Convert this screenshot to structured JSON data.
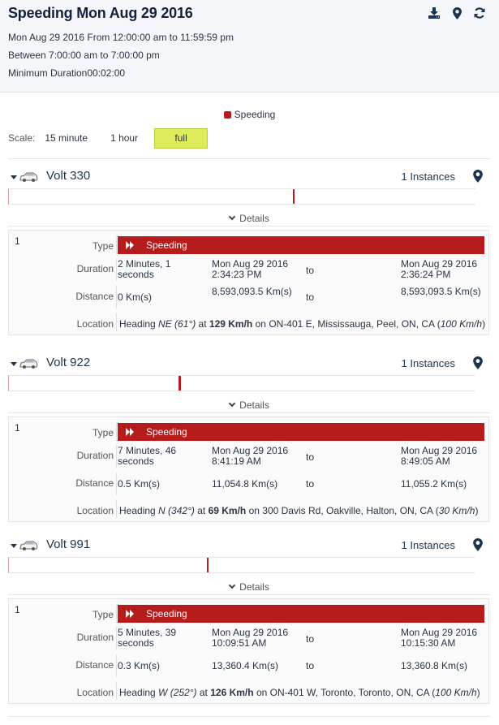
{
  "header": {
    "title": "Speeding Mon Aug 29 2016",
    "date_range": "Mon Aug 29 2016 From 12:00:00 am to 11:59:59 pm",
    "between": "Between 7:00:00 am to 7:00:00 pm",
    "min_duration": "Minimum Duration00:02:00",
    "tools": [
      "download-icon",
      "map-pin-icon",
      "refresh-icon"
    ]
  },
  "legend": {
    "label": "Speeding",
    "color": "#b71c1c"
  },
  "scale": {
    "label": "Scale:",
    "options": [
      "15 minute",
      "1 hour",
      "full"
    ],
    "selected": "full",
    "highlight_color": "#dcec5c"
  },
  "timeline": {
    "range_hours": [
      0,
      24
    ]
  },
  "labels": {
    "details": "Details",
    "type": "Type",
    "duration": "Duration",
    "distance": "Distance",
    "location": "Location",
    "to": "to",
    "heading": "Heading",
    "at": "at",
    "on": "on"
  },
  "vehicles": [
    {
      "name": "Volt 330",
      "instances": "1 Instances",
      "events": [
        {
          "index": "1",
          "type": "Speeding",
          "start_hour": 14.573,
          "end_hour": 14.607,
          "duration": "2 Minutes, 1 seconds",
          "start_time": "Mon Aug 29 2016 2:34:23 PM",
          "end_time": "Mon Aug 29 2016 2:36:24 PM",
          "distance": "0 Km(s)",
          "odo_start": "8,593,093.5 Km(s)",
          "odo_end": "8,593,093.5 Km(s)",
          "heading": "NE (61°)",
          "speed": "129 Km/h",
          "address": "ON-401 E, Mississauga, Peel, ON, CA",
          "limit": "100 Km/h"
        }
      ]
    },
    {
      "name": "Volt 922",
      "instances": "1 Instances",
      "events": [
        {
          "index": "1",
          "type": "Speeding",
          "start_hour": 8.689,
          "end_hour": 8.818,
          "duration": "7 Minutes, 46 seconds",
          "start_time": "Mon Aug 29 2016 8:41:19 AM",
          "end_time": "Mon Aug 29 2016 8:49:05 AM",
          "distance": "0.5 Km(s)",
          "odo_start": "11,054.8 Km(s)",
          "odo_end": "11,055.2 Km(s)",
          "heading": "N (342°)",
          "speed": "69 Km/h",
          "address": "300 Davis Rd, Oakville, Halton, ON, CA",
          "limit": "30 Km/h"
        }
      ]
    },
    {
      "name": "Volt 991",
      "instances": "1 Instances",
      "events": [
        {
          "index": "1",
          "type": "Speeding",
          "start_hour": 10.164,
          "end_hour": 10.258,
          "duration": "5 Minutes, 39 seconds",
          "start_time": "Mon Aug 29 2016 10:09:51 AM",
          "end_time": "Mon Aug 29 2016 10:15:30 AM",
          "distance": "0.3 Km(s)",
          "odo_start": "13,360.4 Km(s)",
          "odo_end": "13,360.8 Km(s)",
          "heading": "W (252°)",
          "speed": "126 Km/h",
          "address": "ON-401 W, Toronto, Toronto, ON, CA",
          "limit": "100 Km/h"
        }
      ]
    }
  ]
}
